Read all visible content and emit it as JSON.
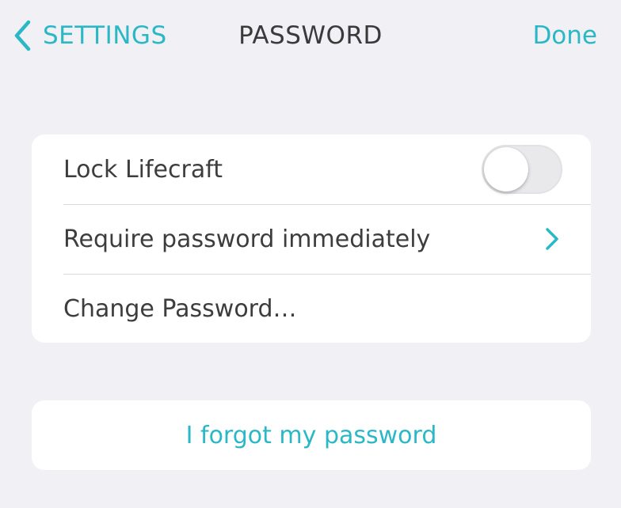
{
  "nav": {
    "back_label": "SETTINGS",
    "title": "PASSWORD",
    "done_label": "Done"
  },
  "settings": {
    "lock": {
      "label": "Lock Lifecraft",
      "enabled": false
    },
    "require": {
      "label": "Require password immediately",
      "icon": "chevron-right-icon"
    },
    "change": {
      "label": "Change Password…"
    }
  },
  "forgot": {
    "label": "I forgot my password"
  },
  "colors": {
    "accent": "#2bb8c6",
    "background": "#f1f0f5",
    "card": "#ffffff",
    "text": "#3d3d3d",
    "toggle_off": "#e9e9ec"
  }
}
